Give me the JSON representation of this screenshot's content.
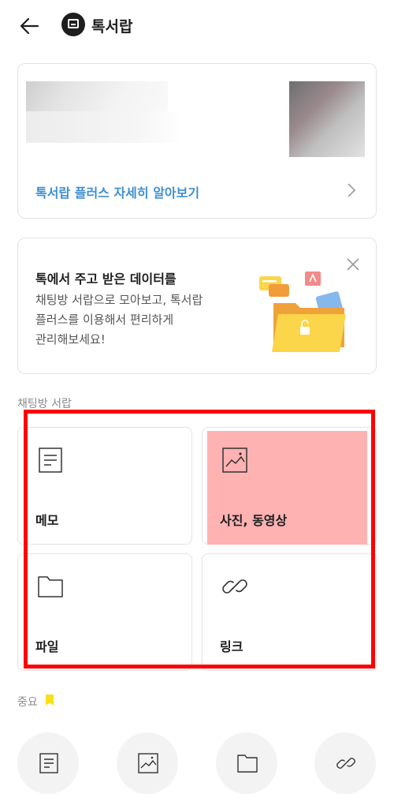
{
  "header": {
    "title": "톡서랍",
    "back_icon": "back-arrow-icon",
    "logo_icon": "talk-drawer-logo-icon"
  },
  "plus_card": {
    "link_text": "톡서랍 플러스 자세히 알아보기",
    "link_color": "#3f8fd2"
  },
  "info_card": {
    "title": "톡에서 주고 받은 데이터를",
    "desc_lines": [
      "채팅방 서랍으로 모아보고, 톡서랍",
      "플러스를 이용해서 편리하게",
      "관리해보세요!"
    ]
  },
  "drawer_section": {
    "label": "채팅방 서랍",
    "tiles": [
      {
        "label": "메모",
        "icon": "memo-icon"
      },
      {
        "label": "사진, 동영상",
        "icon": "photo-icon"
      },
      {
        "label": "파일",
        "icon": "folder-icon"
      },
      {
        "label": "링크",
        "icon": "link-icon"
      }
    ]
  },
  "important_section": {
    "label": "중요",
    "flag_color": "#fadf1a",
    "shortcuts": [
      "memo-icon",
      "photo-icon",
      "folder-icon",
      "link-icon"
    ]
  },
  "highlight": {
    "outline_color": "#ff0000",
    "fill_color": "#ffb2b2"
  }
}
